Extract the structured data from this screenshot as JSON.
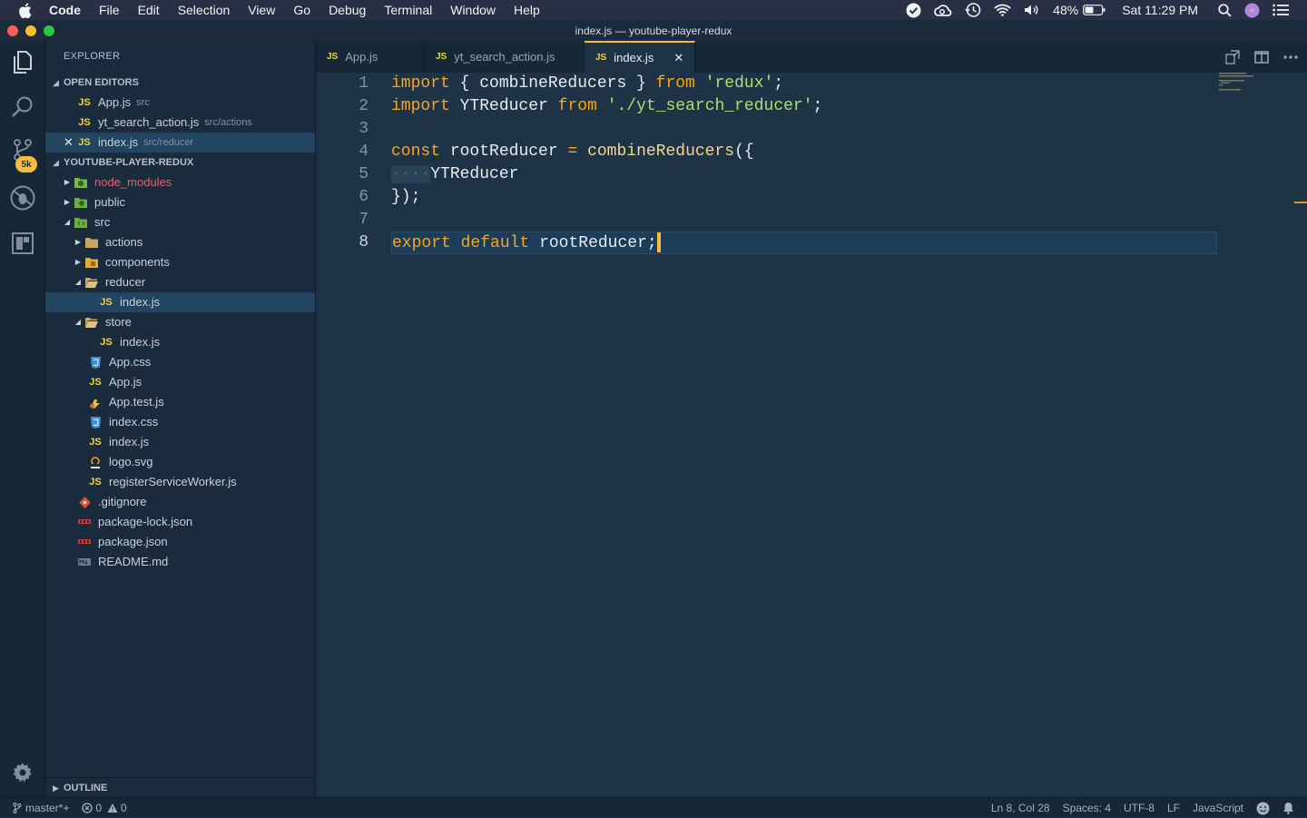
{
  "menubar": {
    "app": "Code",
    "items": [
      "File",
      "Edit",
      "Selection",
      "View",
      "Go",
      "Debug",
      "Terminal",
      "Window",
      "Help"
    ],
    "battery": "48%",
    "clock": "Sat 11:29 PM"
  },
  "window": {
    "title": "index.js — youtube-player-redux"
  },
  "activity": {
    "badge": "5k"
  },
  "explorer": {
    "title": "EXPLORER",
    "open_editors_label": "OPEN EDITORS",
    "open_editors": [
      {
        "name": "App.js",
        "desc": "src"
      },
      {
        "name": "yt_search_action.js",
        "desc": "src/actions"
      },
      {
        "name": "index.js",
        "desc": "src/reducer"
      }
    ],
    "project_label": "YOUTUBE-PLAYER-REDUX",
    "tree": [
      {
        "name": "node_modules"
      },
      {
        "name": "public"
      },
      {
        "name": "src"
      },
      {
        "name": "actions"
      },
      {
        "name": "components"
      },
      {
        "name": "reducer"
      },
      {
        "name": "index.js"
      },
      {
        "name": "store"
      },
      {
        "name": "index.js"
      },
      {
        "name": "App.css"
      },
      {
        "name": "App.js"
      },
      {
        "name": "App.test.js"
      },
      {
        "name": "index.css"
      },
      {
        "name": "index.js"
      },
      {
        "name": "logo.svg"
      },
      {
        "name": "registerServiceWorker.js"
      },
      {
        "name": ".gitignore"
      },
      {
        "name": "package-lock.json"
      },
      {
        "name": "package.json"
      },
      {
        "name": "README.md"
      }
    ],
    "outline_label": "OUTLINE"
  },
  "tabs": [
    {
      "label": "App.js",
      "type": "JS"
    },
    {
      "label": "yt_search_action.js",
      "type": "JS"
    },
    {
      "label": "index.js",
      "type": "JS"
    }
  ],
  "editor": {
    "line_numbers": [
      "1",
      "2",
      "3",
      "4",
      "5",
      "6",
      "7",
      "8"
    ],
    "tokens": {
      "import": "import",
      "from": "from",
      "const": "const",
      "export": "export",
      "default": "default",
      "combineReducers": "combineReducers",
      "redux": "'redux'",
      "YTReducer": "YTReducer",
      "yt_path": "'./yt_search_reducer'",
      "rootReducer": "rootReducer",
      "indent_dots": "····"
    }
  },
  "statusbar": {
    "branch": "master*+",
    "errors": "0",
    "warnings": "0",
    "position": "Ln 8, Col 28",
    "spaces": "Spaces: 4",
    "encoding": "UTF-8",
    "eol": "LF",
    "language": "JavaScript"
  },
  "colors": {
    "accent": "#f4be3c",
    "keyword": "#f5a623",
    "string": "#a5e26b",
    "background": "#1f3346"
  }
}
